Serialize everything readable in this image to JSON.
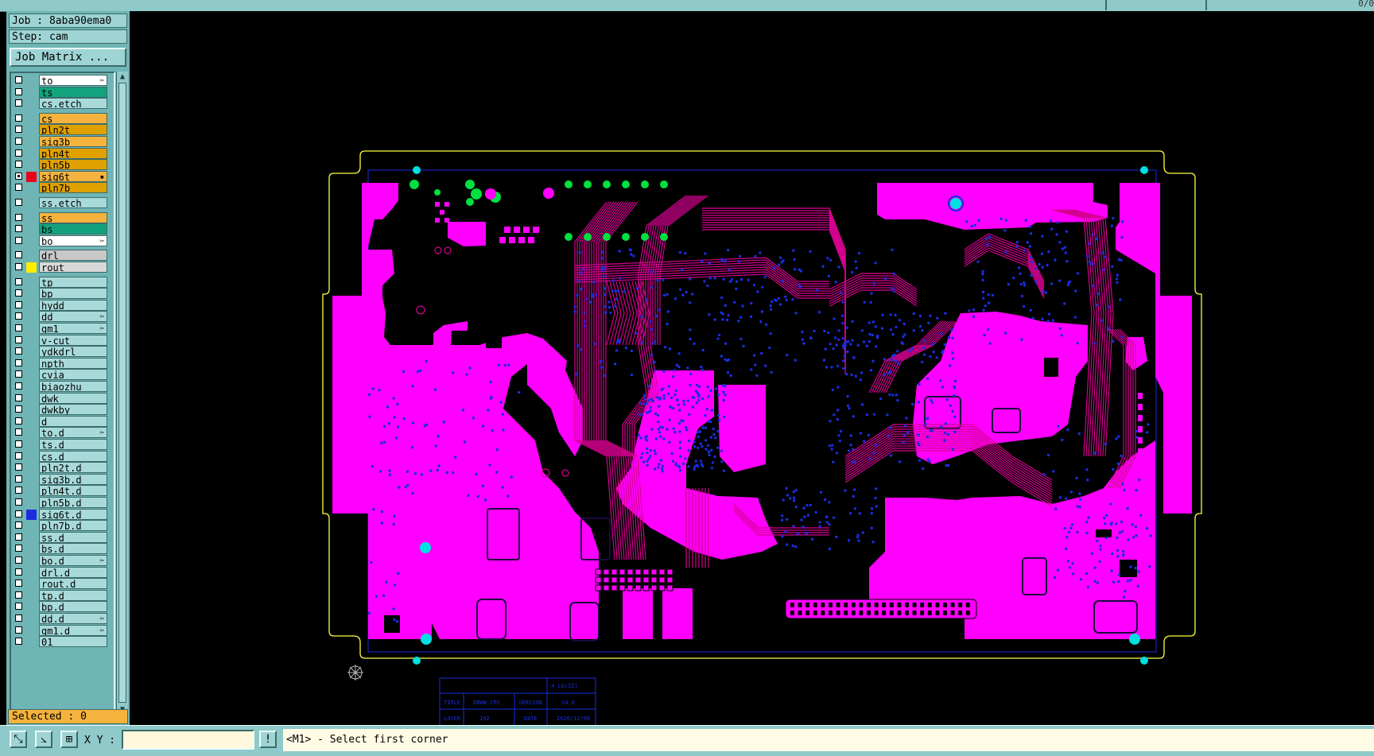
{
  "top_bar": {
    "corner_text": "0/0"
  },
  "job": {
    "job_label": "Job : 8aba90ema0",
    "step_label": "Step: cam",
    "matrix_button": "Job Matrix ..."
  },
  "layers": [
    {
      "name": "to",
      "color": "#ffffff",
      "swatch": "",
      "mark": "✂",
      "checked": false
    },
    {
      "name": "ts",
      "color": "#12a37c",
      "swatch": "",
      "mark": "",
      "checked": false
    },
    {
      "name": "cs.etch",
      "color": "#a8dada",
      "swatch": "",
      "mark": "",
      "checked": false
    },
    {
      "name": "cs",
      "color": "#f5b33d",
      "swatch": "",
      "mark": "",
      "checked": false
    },
    {
      "name": "pln2t",
      "color": "#e0a000",
      "swatch": "",
      "mark": "",
      "checked": false
    },
    {
      "name": "sig3b",
      "color": "#f5b33d",
      "swatch": "",
      "mark": "",
      "checked": false
    },
    {
      "name": "pln4t",
      "color": "#e0a000",
      "swatch": "",
      "mark": "",
      "checked": false
    },
    {
      "name": "pln5b",
      "color": "#e0a000",
      "swatch": "",
      "mark": "",
      "checked": false
    },
    {
      "name": "sig6t",
      "color": "#f5b33d",
      "swatch": "#e8001c",
      "mark": "▪",
      "checked": true
    },
    {
      "name": "pln7b",
      "color": "#e0a000",
      "swatch": "",
      "mark": "",
      "checked": false
    },
    {
      "name": "ss.etch",
      "color": "#a8dada",
      "swatch": "",
      "mark": "",
      "checked": false
    },
    {
      "name": "ss",
      "color": "#f5b33d",
      "swatch": "",
      "mark": "",
      "checked": false
    },
    {
      "name": "bs",
      "color": "#12a37c",
      "swatch": "",
      "mark": "",
      "checked": false
    },
    {
      "name": "bo",
      "color": "#ffffff",
      "swatch": "",
      "mark": "✂",
      "checked": false
    },
    {
      "name": "drl",
      "color": "#c8c8c8",
      "swatch": "",
      "mark": "",
      "checked": false
    },
    {
      "name": "rout",
      "color": "#d8d8d8",
      "swatch": "#ffee00",
      "mark": "",
      "checked": false
    },
    {
      "name": "tp",
      "color": "#a8dada",
      "swatch": "",
      "mark": "",
      "checked": false
    },
    {
      "name": "bp",
      "color": "#a8dada",
      "swatch": "",
      "mark": "",
      "checked": false
    },
    {
      "name": "hydd",
      "color": "#a8dada",
      "swatch": "",
      "mark": "",
      "checked": false
    },
    {
      "name": "dd",
      "color": "#a8dada",
      "swatch": "",
      "mark": "✂",
      "checked": false
    },
    {
      "name": "gm1",
      "color": "#a8dada",
      "swatch": "",
      "mark": "✂",
      "checked": false
    },
    {
      "name": "v-cut",
      "color": "#a8dada",
      "swatch": "",
      "mark": "",
      "checked": false
    },
    {
      "name": "ydkdrl",
      "color": "#a8dada",
      "swatch": "",
      "mark": "",
      "checked": false
    },
    {
      "name": "npth",
      "color": "#a8dada",
      "swatch": "",
      "mark": "",
      "checked": false
    },
    {
      "name": "cvia",
      "color": "#a8dada",
      "swatch": "",
      "mark": "",
      "checked": false
    },
    {
      "name": "biaozhu",
      "color": "#a8dada",
      "swatch": "",
      "mark": "",
      "checked": false
    },
    {
      "name": "dwk",
      "color": "#a8dada",
      "swatch": "",
      "mark": "",
      "checked": false
    },
    {
      "name": "dwkby",
      "color": "#a8dada",
      "swatch": "",
      "mark": "",
      "checked": false
    },
    {
      "name": "d",
      "color": "#a8dada",
      "swatch": "",
      "mark": "",
      "checked": false
    },
    {
      "name": "to.d",
      "color": "#a8dada",
      "swatch": "",
      "mark": "✂",
      "checked": false
    },
    {
      "name": "ts.d",
      "color": "#a8dada",
      "swatch": "",
      "mark": "",
      "checked": false
    },
    {
      "name": "cs.d",
      "color": "#a8dada",
      "swatch": "",
      "mark": "",
      "checked": false
    },
    {
      "name": "pln2t.d",
      "color": "#a8dada",
      "swatch": "",
      "mark": "",
      "checked": false
    },
    {
      "name": "sig3b.d",
      "color": "#a8dada",
      "swatch": "",
      "mark": "",
      "checked": false
    },
    {
      "name": "pln4t.d",
      "color": "#a8dada",
      "swatch": "",
      "mark": "",
      "checked": false
    },
    {
      "name": "pln5b.d",
      "color": "#a8dada",
      "swatch": "",
      "mark": "",
      "checked": false
    },
    {
      "name": "sig6t.d",
      "color": "#a8dada",
      "swatch": "#1a2de0",
      "mark": "",
      "checked": false
    },
    {
      "name": "pln7b.d",
      "color": "#a8dada",
      "swatch": "",
      "mark": "",
      "checked": false
    },
    {
      "name": "ss.d",
      "color": "#a8dada",
      "swatch": "",
      "mark": "",
      "checked": false
    },
    {
      "name": "bs.d",
      "color": "#a8dada",
      "swatch": "",
      "mark": "",
      "checked": false
    },
    {
      "name": "bo.d",
      "color": "#a8dada",
      "swatch": "",
      "mark": "✂",
      "checked": false
    },
    {
      "name": "drl.d",
      "color": "#a8dada",
      "swatch": "",
      "mark": "",
      "checked": false
    },
    {
      "name": "rout.d",
      "color": "#a8dada",
      "swatch": "",
      "mark": "",
      "checked": false
    },
    {
      "name": "tp.d",
      "color": "#a8dada",
      "swatch": "",
      "mark": "",
      "checked": false
    },
    {
      "name": "bp.d",
      "color": "#a8dada",
      "swatch": "",
      "mark": "",
      "checked": false
    },
    {
      "name": "dd.d",
      "color": "#a8dada",
      "swatch": "",
      "mark": "✂",
      "checked": false
    },
    {
      "name": "gm1.d",
      "color": "#a8dada",
      "swatch": "",
      "mark": "✂",
      "checked": false
    },
    {
      "name": "01",
      "color": "#a8dada",
      "swatch": "",
      "mark": "",
      "checked": false
    }
  ],
  "selected_label": "Selected : 0",
  "bottom": {
    "xy_label": "X Y :",
    "xy_value": "",
    "status_message": "<M1> - Select first corner"
  },
  "colors": {
    "copper": "#ff00ff",
    "trace": "#d60090",
    "via": "#1a2de0",
    "pad": "#00e040",
    "drill": "#00e0e0",
    "outline": "#ffff40",
    "board_border": "#1a2de0",
    "background": "#000000"
  },
  "title_block": [
    {
      "label": "TITLE",
      "value": "DBWW_CPU"
    },
    {
      "label": "VERSION",
      "value": "V4.0"
    },
    {
      "label": "LAYER",
      "value": "102"
    },
    {
      "label": "DATE",
      "value": "2020/12/08"
    }
  ],
  "icons": [
    "cursor-crosshair-icon",
    "zoom-area-icon",
    "select-line-icon",
    "grid-snap-icon"
  ]
}
